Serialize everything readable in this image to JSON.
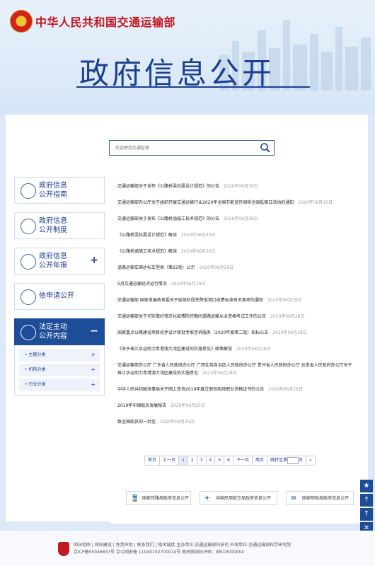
{
  "site": {
    "name": "中华人民共和国交通运输部",
    "heading": "政府信息公开"
  },
  "search": {
    "placeholder": "欢迎使用交通智搜"
  },
  "sidebar": {
    "items": [
      {
        "label1": "政府信息",
        "label2": "公开指南",
        "has_plus": false,
        "active": false
      },
      {
        "label1": "政府信息",
        "label2": "公开制度",
        "has_plus": false,
        "active": false
      },
      {
        "label1": "政府信息",
        "label2": "公开年报",
        "has_plus": true,
        "active": false
      },
      {
        "label1": "依申请公开",
        "label2": "",
        "has_plus": false,
        "active": false
      },
      {
        "label1": "法定主动",
        "label2": "公开内容",
        "has_plus": false,
        "active": true,
        "toggle": "−"
      }
    ],
    "sub_items": [
      "主题分类",
      "机构分类",
      "行业分类"
    ]
  },
  "articles": [
    {
      "title": "交通运输部关于发布《公路桥梁抗震设计规范》的公告",
      "date": "2020年06月30日"
    },
    {
      "title": "交通运输部办公厅关于组织开展交通运输行业2020年全国节能宣传周和全国低碳日活动的通知",
      "date": "2020年06月30日"
    },
    {
      "title": "交通运输部关于发布《公路桥涵施工技术规范》的公告",
      "date": "2020年06月30日"
    },
    {
      "title": "《公路桥梁抗震设计规范》解读",
      "date": "2020年06月30日"
    },
    {
      "title": "《公路桥涵施工技术规范》解读",
      "date": "2020年06月30日"
    },
    {
      "title": "道路运输车辆达标车型表（第22批）公示",
      "date": "2020年06月29日"
    },
    {
      "title": "5月交通运输经济运行情况",
      "date": "2020年06月29日"
    },
    {
      "title": "交通运输部 国家发展改革委关于延续阶段性降低港口收费标准有关事项的通知",
      "date": "2020年06月29日"
    },
    {
      "title": "交通运输部关于切实做好常态化疫情防控期间道路运输从业资格考试工作的公告",
      "date": "2020年06月28日"
    },
    {
      "title": "国家重点公路建设项目初步设计审批专家咨询服务（2020年度第二批）招标公告",
      "date": "2020年06月28日"
    },
    {
      "title": "《关于珠江水运助力粤港澳大湾区建设的实施意见》政策解读",
      "date": "2020年06月28日"
    },
    {
      "title": "交通运输部办公厅 广东省人民政府办公厅 广西壮族自治区人民政府办公厅 贵州省人民政府办公厅 云南省人民政府办公厅关于珠江水运助力粤港澳大湾区建设的实施意见",
      "date": "2020年06月28日"
    },
    {
      "title": "中华人民共和国海事局关于网上查询2019年度注册验船师职业资格证书的公告",
      "date": "2020年06月25日"
    },
    {
      "title": "2019年中国船员发展报告",
      "date": "2020年06月25日"
    },
    {
      "title": "致全国船员的一封信",
      "date": "2020年06月25日"
    }
  ],
  "pager": {
    "first": "首页",
    "prev": "上一页",
    "pages": [
      "1",
      "2",
      "3",
      "4",
      "5",
      "6"
    ],
    "current": "1",
    "next": "下一页",
    "last": "尾页",
    "jump_label": "跳转至第",
    "jump_unit": "页",
    "go": "»"
  },
  "related_links": [
    {
      "label": "国家铁路局政府信息公开",
      "icon": "train-icon",
      "glyph": "🚆"
    },
    {
      "label": "中国民用航空局政府信息公开",
      "icon": "plane-icon",
      "glyph": "✈"
    },
    {
      "label": "国家邮政局政府信息公开",
      "icon": "postal-icon",
      "glyph": "✉"
    }
  ],
  "float_bar": [
    {
      "name": "favorite-icon",
      "glyph": "★"
    },
    {
      "name": "top-icon",
      "glyph": "⤒"
    },
    {
      "name": "up-icon",
      "glyph": "↑"
    },
    {
      "name": "close-icon",
      "glyph": "✕"
    }
  ],
  "footer": {
    "line1": "网站地图 | 网站建设 | 免责声明 | 联系我们 | 相关链接  主办单位:交通运输部科技司 开发单位:交通运输部科学研究院",
    "line2": "京ICP备05046837号  京公网安备 11040102700014号  政府网站标识码：BM19000004"
  },
  "colors": {
    "brand": "#1d3f8f",
    "red": "#c3191f",
    "active": "#1d4d99"
  }
}
